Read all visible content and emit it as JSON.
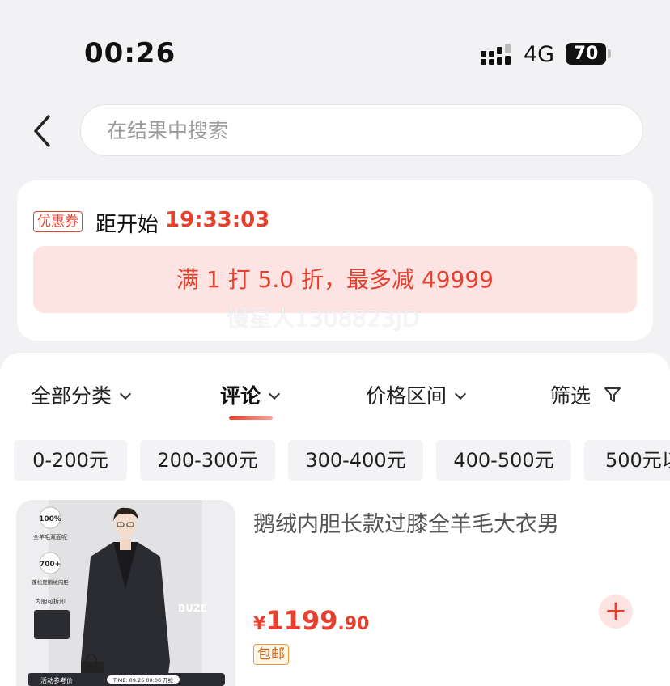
{
  "status_bar": {
    "time": "00:26",
    "network": "4G",
    "battery": "70"
  },
  "search": {
    "placeholder": "在结果中搜索"
  },
  "coupon": {
    "tag": "优惠券",
    "countdown_label": "距开始",
    "countdown": "19:33:03",
    "promo": "满 1 打 5.0 折，最多减 49999"
  },
  "watermark": "慢星人1308823JD",
  "sort_tabs": [
    {
      "label": "全部分类"
    },
    {
      "label": "评论"
    },
    {
      "label": "价格区间"
    },
    {
      "label": "筛选"
    }
  ],
  "price_chips": [
    "0-200元",
    "200-300元",
    "300-400元",
    "400-500元",
    "500元以"
  ],
  "product": {
    "title": "鹅绒内胆长款过膝全羊毛大衣男",
    "price_symbol": "¥",
    "price_int": "1199",
    "price_dec": ".90",
    "shipping": "包邮",
    "image": {
      "badge1": "100%",
      "badge1_caption": "全羊毛双面呢",
      "badge2": "700+",
      "badge2_caption": "蓬松度鹅绒内胆",
      "liner_caption": "内胆可拆卸",
      "brand": "BUZE",
      "footer_left": "活动参考价",
      "footer_time": "TIME: 09.26 00:00 开抢"
    }
  },
  "colors": {
    "accent": "#e8402f",
    "promo_bg": "#fde3e1",
    "page_bg": "#f2f2f4"
  }
}
